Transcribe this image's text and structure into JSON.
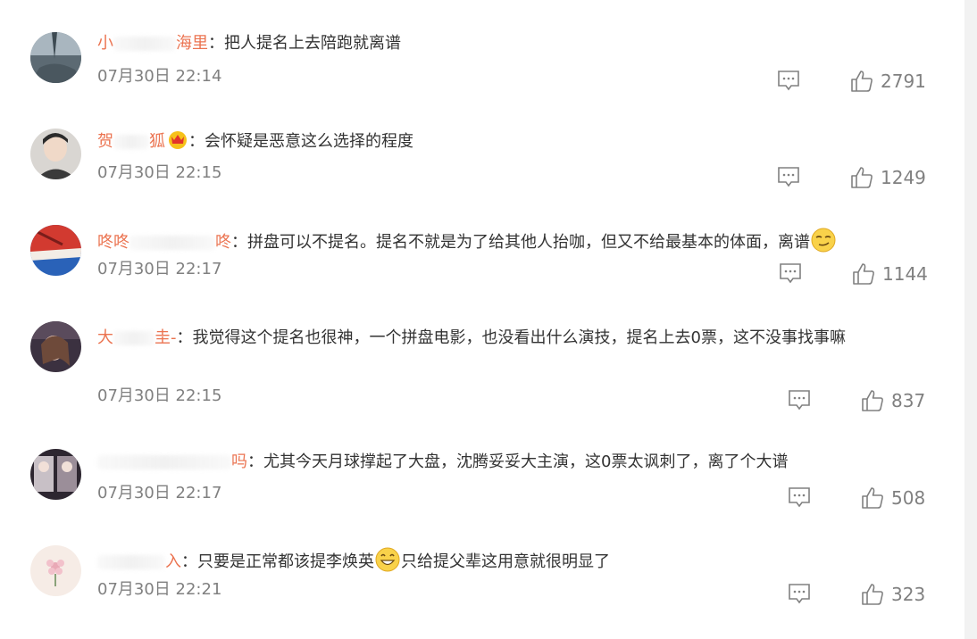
{
  "comments": [
    {
      "user_left": "小",
      "user_right": "海里",
      "text": "把人提名上去陪跑就离谱",
      "time": "07月30日 22:14",
      "likes": "2791"
    },
    {
      "user_left": "贺",
      "user_right": "狐",
      "text": "会怀疑是恶意这么选择的程度",
      "time": "07月30日 22:15",
      "likes": "1249"
    },
    {
      "user_left": "咚咚",
      "user_right": "咚",
      "text": "拼盘可以不提名。提名不就是为了给其他人抬咖，但又不给最基本的体面，离谱",
      "time": "07月30日 22:17",
      "likes": "1144"
    },
    {
      "user_left": "大",
      "user_right": "圭-",
      "text": "我觉得这个提名也很神，一个拼盘电影，也没看出什么演技，提名上去0票，这不没事找事嘛",
      "time": "07月30日 22:15",
      "likes": "837"
    },
    {
      "user_left": "",
      "user_right": "吗",
      "text": "尤其今天月球撑起了大盘，沈腾妥妥大主演，这0票太讽刺了，离了个大谱",
      "time": "07月30日 22:17",
      "likes": "508"
    },
    {
      "user_left": "",
      "user_right": "入",
      "text_before": "只要是正常都该提李焕英",
      "text_after": "只给提父辈这用意就很明显了",
      "time": "07月30日 22:21",
      "likes": "323"
    }
  ],
  "colon": "："
}
